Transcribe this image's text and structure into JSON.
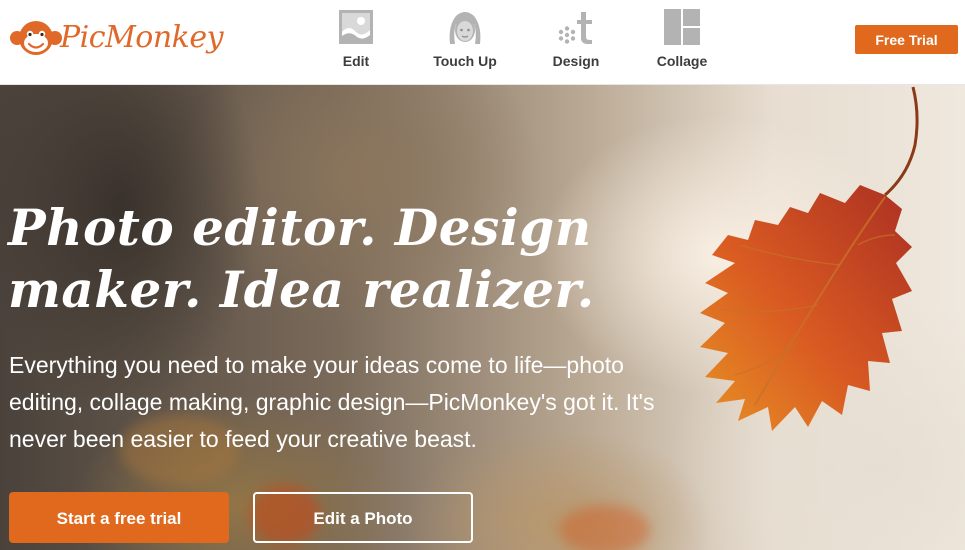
{
  "brand": {
    "name": "PicMonkey",
    "color": "#e0692a",
    "logo_icon": "monkey-face-icon"
  },
  "nav": {
    "items": [
      {
        "label": "Edit",
        "icon": "image-icon"
      },
      {
        "label": "Touch Up",
        "icon": "face-icon"
      },
      {
        "label": "Design",
        "icon": "design-icon"
      },
      {
        "label": "Collage",
        "icon": "collage-icon"
      }
    ],
    "icon_color": "#b3b3b3"
  },
  "header": {
    "cta_label": "Free Trial"
  },
  "hero": {
    "title": "Photo editor. Design maker. Idea realizer.",
    "subtitle": "Everything you need to make your ideas come to life—photo editing, collage making, graphic design—PicMonkey's got it. It's never been easier to feed your creative beast.",
    "primary_cta": "Start a free trial",
    "secondary_cta": "Edit a Photo",
    "background_icon": "autumn-leaf-image"
  },
  "colors": {
    "accent": "#e0691d",
    "text_on_hero": "#ffffff"
  }
}
